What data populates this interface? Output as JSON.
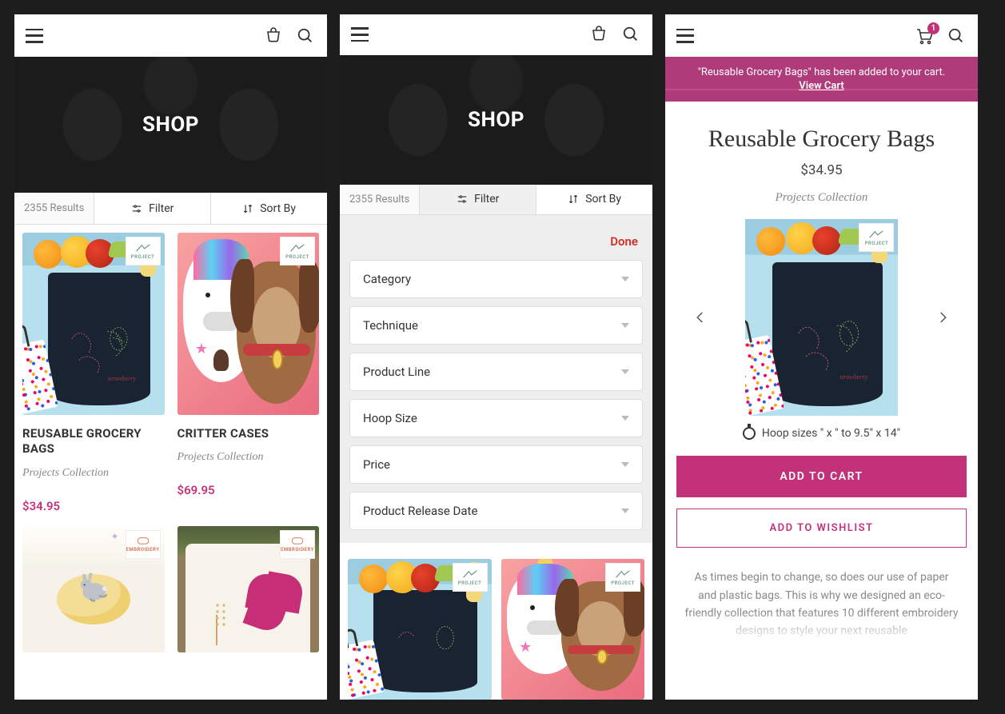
{
  "shop": {
    "title": "SHOP",
    "results": "2355 Results",
    "filter_label": "Filter",
    "sort_label": "Sort By"
  },
  "products": [
    {
      "name": "REUSABLE GROCERY BAGS",
      "collection": "Projects Collection",
      "price": "$34.95",
      "badge": "PROJECT"
    },
    {
      "name": "CRITTER CASES",
      "collection": "Projects Collection",
      "price": "$69.95",
      "badge": "PROJECT"
    },
    {
      "badge_type": "embroidery"
    },
    {
      "badge_type": "embroidery"
    }
  ],
  "filter": {
    "done": "Done",
    "facets": [
      {
        "label": "Category"
      },
      {
        "label": "Technique"
      },
      {
        "label": "Product Line"
      },
      {
        "label": "Hoop Size"
      },
      {
        "label": "Price"
      },
      {
        "label": "Product Release Date"
      }
    ]
  },
  "pdp": {
    "cart_count": "1",
    "notice_text": "\"Reusable Grocery Bags\" has been added to your cart.",
    "view_cart": "View Cart",
    "title": "Reusable Grocery Bags",
    "price": "$34.95",
    "collection": "Projects Collection",
    "hoop": "Hoop sizes \" x \" to 9.5\" x 14\"",
    "add_to_cart": "ADD TO CART",
    "add_to_wishlist": "ADD TO WISHLIST",
    "description": "As times begin to change, so does our use of paper and plastic bags. This is why we designed an eco-friendly collection that features 10 different embroidery designs to style your next reusable"
  }
}
